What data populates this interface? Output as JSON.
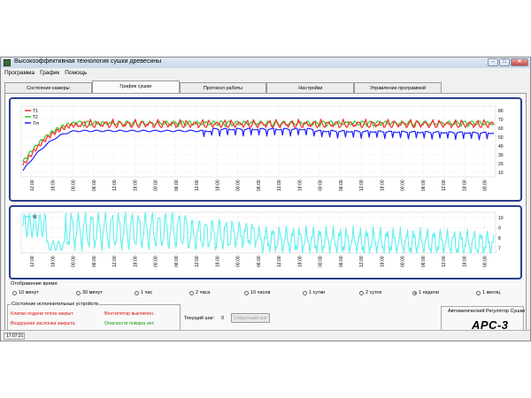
{
  "window": {
    "title": "Высокоэффективная технология сушки древесины",
    "buttons": {
      "minimize": "–",
      "maximize": "□",
      "close": "✕"
    }
  },
  "menu": [
    "Программа",
    "График",
    "Помощь"
  ],
  "tabs": [
    "Состояние камеры",
    "График сушки",
    "Протокол работы",
    "Настройки",
    "Управление программой"
  ],
  "active_tab": 1,
  "charts": {
    "top": {
      "legend": [
        {
          "name": "T1",
          "color": "#ff2a2a"
        },
        {
          "name": "T2",
          "color": "#2ad02a"
        },
        {
          "name": "Tm",
          "color": "#2020ff"
        }
      ],
      "y_ticks": [
        "80",
        "70",
        "60",
        "50",
        "40",
        "30",
        "20",
        "10"
      ],
      "x_ticks": [
        "12:00",
        "18:00",
        "00:00",
        "06:00",
        "12:00",
        "18:00",
        "00:00",
        "06:00",
        "12:00",
        "18:00",
        "00:00",
        "06:00",
        "12:00",
        "18:00",
        "00:00",
        "06:00",
        "12:00",
        "18:00",
        "00:00",
        "06:00",
        "12:00",
        "18:00",
        "00:00"
      ]
    },
    "bottom": {
      "legend": [
        {
          "name": "W",
          "color": "#5ef0f0"
        }
      ],
      "y_ticks": [
        "10",
        "9",
        "8",
        "7"
      ],
      "x_ticks": [
        "12:00",
        "18:00",
        "00:00",
        "06:00",
        "12:00",
        "18:00",
        "00:00",
        "06:00",
        "12:00",
        "18:00",
        "00:00",
        "06:00",
        "12:00",
        "18:00",
        "00:00",
        "06:00",
        "12:00",
        "18:00",
        "00:00",
        "06:00",
        "12:00",
        "18:00",
        "00:00"
      ]
    },
    "colors": {
      "frame": "#2a3f8f",
      "grid": "#d8d8d8",
      "background": "#ffffff"
    }
  },
  "time_display": {
    "label": "Отображение время:",
    "options": [
      "10 минут",
      "30 минут",
      "1 час",
      "2 часа",
      "10 часов",
      "1 сутки",
      "2 суток",
      "1 недели",
      "1 месяц"
    ],
    "selected": 7
  },
  "devices": {
    "title": "Состояние исполнительных устройств",
    "items": [
      {
        "text": "Клапан подачи тепла закрыт.",
        "color": "red"
      },
      {
        "text": "Вентилятор выключен.",
        "color": "red"
      },
      {
        "text": "Воздушная заслонка закрыта.",
        "color": "red"
      },
      {
        "text": "Опасности пожара нет.",
        "color": "green"
      }
    ]
  },
  "step": {
    "label": "Текущий шаг:",
    "value": "0",
    "next_button": "Следующий шаг"
  },
  "regulator": {
    "label": "Автоматический Регулятор Сушки",
    "logo": "АРС-3"
  },
  "statusbar": {
    "text": "17:07:21"
  }
}
